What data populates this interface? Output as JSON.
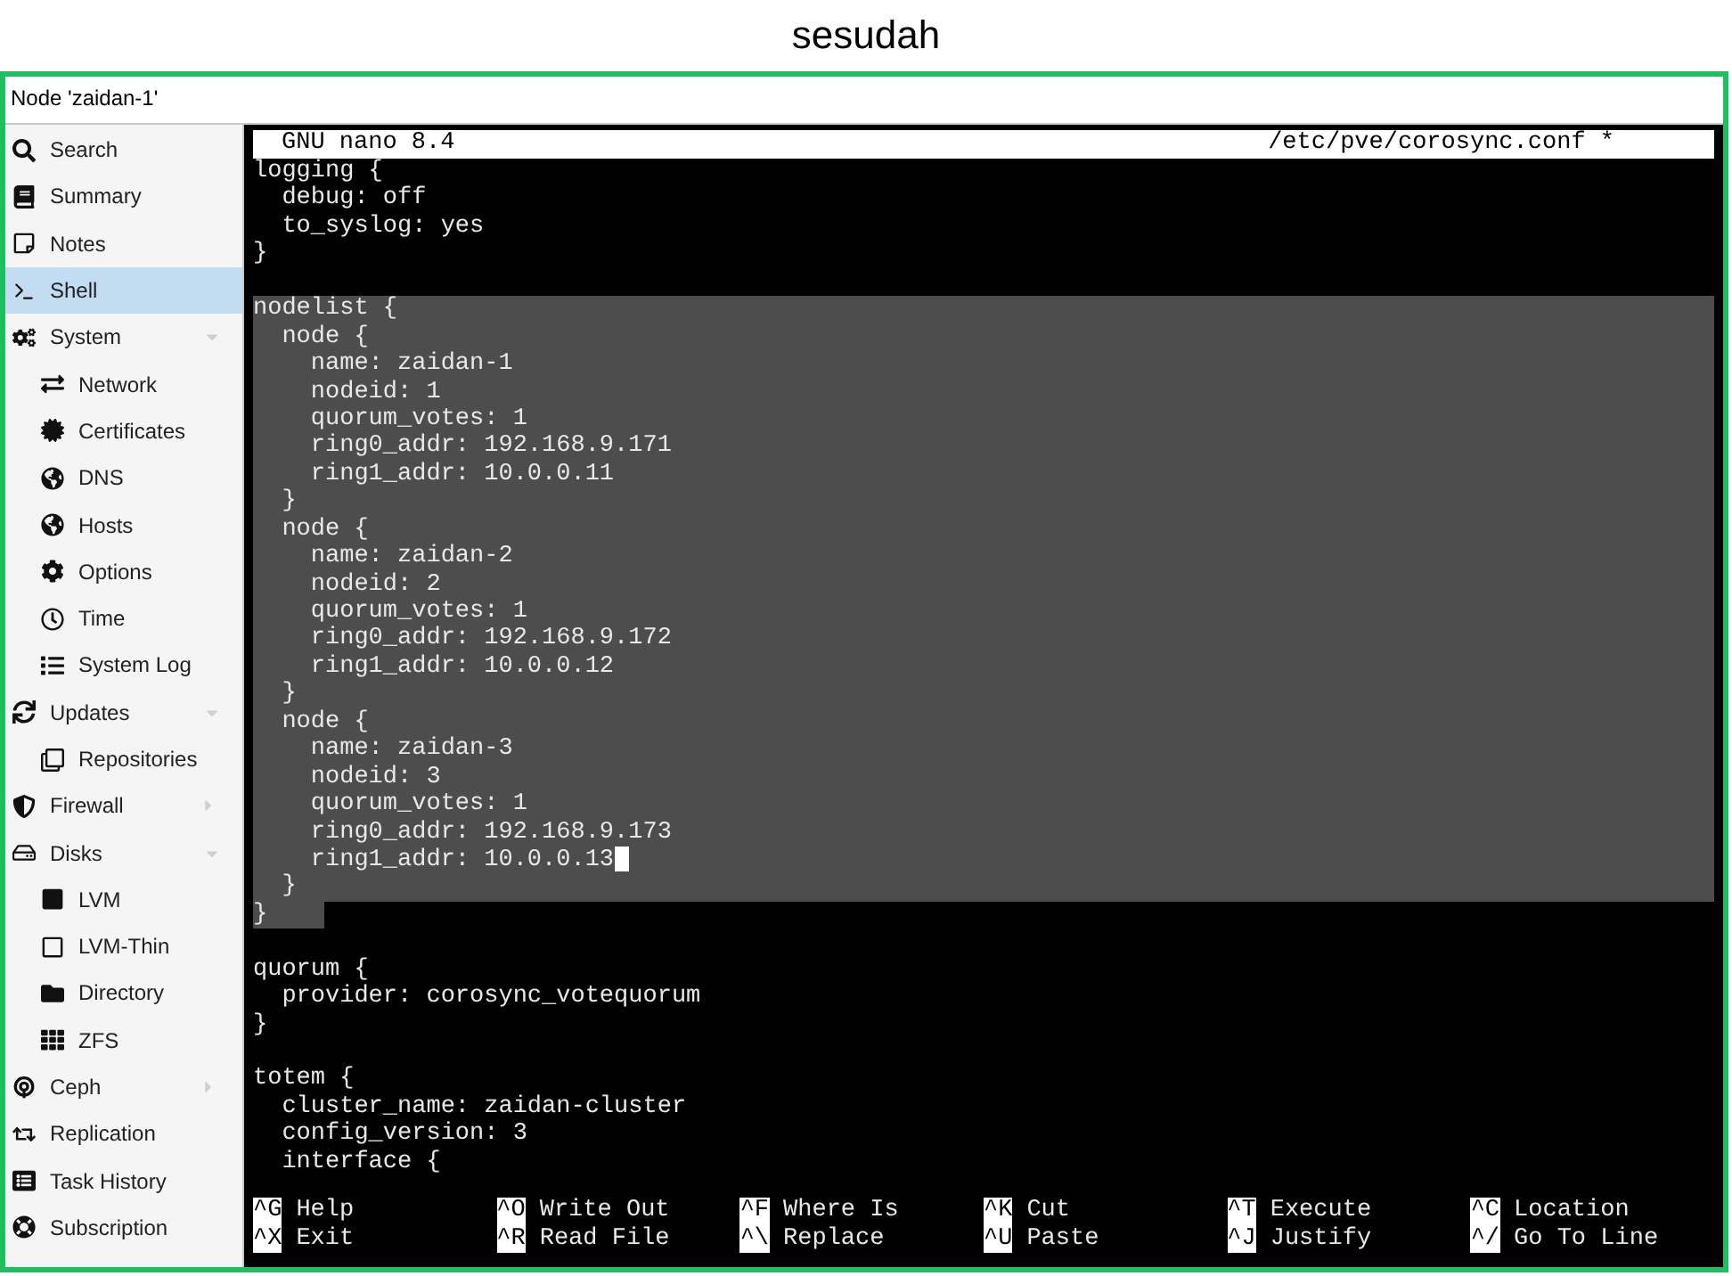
{
  "caption": "sesudah",
  "panel_title": "Node 'zaidan-1'",
  "sidebar": [
    {
      "label": "Search",
      "selected": false
    },
    {
      "label": "Summary",
      "selected": false
    },
    {
      "label": "Notes",
      "selected": false
    },
    {
      "label": "Shell",
      "selected": true
    },
    {
      "label": "System",
      "selected": false,
      "expanded": true,
      "children": [
        {
          "label": "Network",
          "selected": false
        },
        {
          "label": "Certificates",
          "selected": false
        },
        {
          "label": "DNS",
          "selected": false
        },
        {
          "label": "Hosts",
          "selected": false
        },
        {
          "label": "Options",
          "selected": false
        },
        {
          "label": "Time",
          "selected": false
        },
        {
          "label": "System Log",
          "selected": false
        }
      ]
    },
    {
      "label": "Updates",
      "selected": false,
      "expanded": true,
      "children": [
        {
          "label": "Repositories",
          "selected": false
        }
      ]
    },
    {
      "label": "Firewall",
      "selected": false,
      "expanded": false
    },
    {
      "label": "Disks",
      "selected": false,
      "expanded": true,
      "children": [
        {
          "label": "LVM",
          "selected": false
        },
        {
          "label": "LVM-Thin",
          "selected": false
        },
        {
          "label": "Directory",
          "selected": false
        },
        {
          "label": "ZFS",
          "selected": false
        }
      ]
    },
    {
      "label": "Ceph",
      "selected": false,
      "expanded": false
    },
    {
      "label": "Replication",
      "selected": false
    },
    {
      "label": "Task History",
      "selected": false
    },
    {
      "label": "Subscription",
      "selected": false
    }
  ],
  "editor": {
    "app": "GNU nano 8.4",
    "file": "/etc/pve/corosync.conf *",
    "lines": [
      {
        "text": "logging {",
        "selected": false
      },
      {
        "text": "  debug: off",
        "selected": false
      },
      {
        "text": "  to_syslog: yes",
        "selected": false
      },
      {
        "text": "}",
        "selected": false
      },
      {
        "selected": false
      },
      {
        "text": "nodelist {",
        "selected": true,
        "partial": false
      },
      {
        "text": "  node {",
        "selected": true,
        "partial": false
      },
      {
        "text": "    name: zaidan-1",
        "selected": true,
        "partial": false
      },
      {
        "text": "    nodeid: 1",
        "selected": true,
        "partial": false
      },
      {
        "text": "    quorum_votes: 1",
        "selected": true,
        "partial": false
      },
      {
        "text": "    ring0_addr: 192.168.9.171",
        "selected": true,
        "partial": false
      },
      {
        "text": "    ring1_addr: 10.0.0.11",
        "selected": true,
        "partial": false
      },
      {
        "text": "  }",
        "selected": true,
        "partial": false
      },
      {
        "text": "  node {",
        "selected": true,
        "partial": false
      },
      {
        "text": "    name: zaidan-2",
        "selected": true,
        "partial": false
      },
      {
        "text": "    nodeid: 2",
        "selected": true,
        "partial": false
      },
      {
        "text": "    quorum_votes: 1",
        "selected": true,
        "partial": false
      },
      {
        "text": "    ring0_addr: 192.168.9.172",
        "selected": true,
        "partial": false
      },
      {
        "text": "    ring1_addr: 10.0.0.12",
        "selected": true,
        "partial": false
      },
      {
        "text": "  }",
        "selected": true,
        "partial": false
      },
      {
        "text": "  node {",
        "selected": true,
        "partial": false
      },
      {
        "text": "    name: zaidan-3",
        "selected": true,
        "partial": false
      },
      {
        "text": "    nodeid: 3",
        "selected": true,
        "partial": false
      },
      {
        "text": "    quorum_votes: 1",
        "selected": true,
        "partial": false
      },
      {
        "text": "    ring0_addr: 192.168.9.173",
        "selected": true,
        "partial": false
      },
      {
        "text": "    ring1_addr: 10.0.0.13",
        "selected": true,
        "partial": false,
        "cursor": true
      },
      {
        "text": "  }",
        "selected": true,
        "partial": false
      },
      {
        "text": "}",
        "selected": true,
        "partial": true
      },
      {
        "selected": false
      },
      {
        "text": "quorum {",
        "selected": false
      },
      {
        "text": "  provider: corosync_votequorum",
        "selected": false
      },
      {
        "text": "}",
        "selected": false
      },
      {
        "selected": false
      },
      {
        "text": "totem {",
        "selected": false
      },
      {
        "text": "  cluster_name: zaidan-cluster",
        "selected": false
      },
      {
        "text": "  config_version: 3",
        "selected": false
      },
      {
        "text": "  interface {",
        "selected": false
      }
    ],
    "shortcuts": [
      {
        "key": "^G",
        "label": "Help"
      },
      {
        "key": "^O",
        "label": "Write Out"
      },
      {
        "key": "^F",
        "label": "Where Is"
      },
      {
        "key": "^K",
        "label": "Cut"
      },
      {
        "key": "^T",
        "label": "Execute"
      },
      {
        "key": "^C",
        "label": "Location"
      },
      {
        "key": "^X",
        "label": "Exit"
      },
      {
        "key": "^R",
        "label": "Read File"
      },
      {
        "key": "^\\",
        "label": "Replace"
      },
      {
        "key": "^U",
        "label": "Paste"
      },
      {
        "key": "^J",
        "label": "Justify"
      },
      {
        "key": "^/",
        "label": "Go To Line"
      }
    ]
  }
}
